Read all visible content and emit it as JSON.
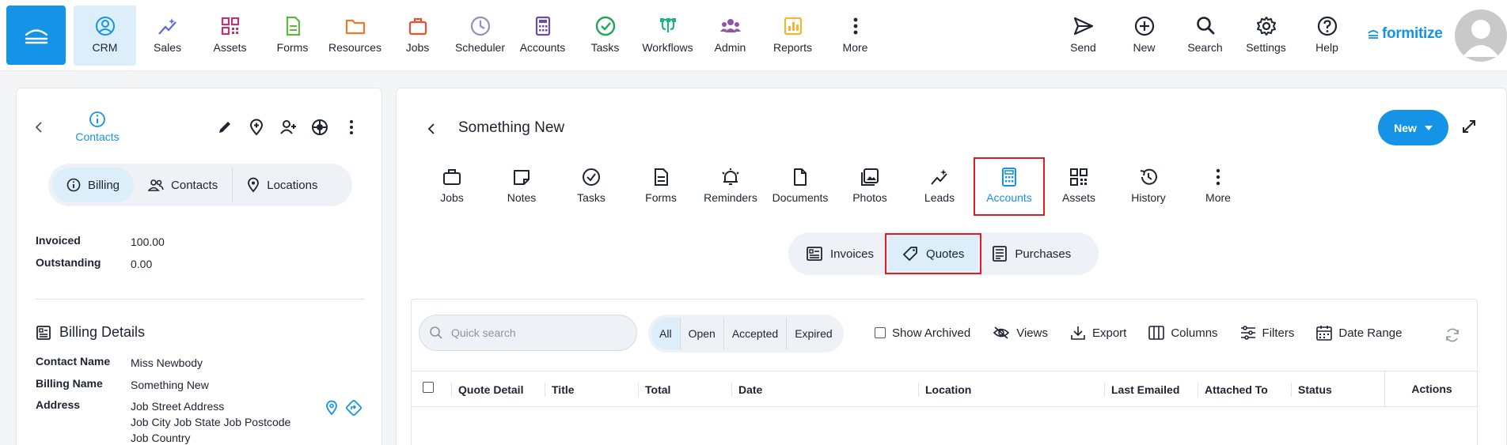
{
  "nav": {
    "items": [
      {
        "label": "CRM",
        "icon": "crm-icon",
        "color": "#1593e6",
        "active": true
      },
      {
        "label": "Sales",
        "icon": "sales-icon",
        "color": "#5b6bd8"
      },
      {
        "label": "Assets",
        "icon": "assets-icon",
        "color": "#b23a74"
      },
      {
        "label": "Forms",
        "icon": "forms-icon",
        "color": "#62b540"
      },
      {
        "label": "Resources",
        "icon": "resources-icon",
        "color": "#ef7a2c"
      },
      {
        "label": "Jobs",
        "icon": "jobs-icon",
        "color": "#e8502f"
      },
      {
        "label": "Scheduler",
        "icon": "scheduler-icon",
        "color": "#9b8ac4"
      },
      {
        "label": "Accounts",
        "icon": "accounts-icon",
        "color": "#6a4ab5"
      },
      {
        "label": "Tasks",
        "icon": "tasks-icon",
        "color": "#23a455"
      },
      {
        "label": "Workflows",
        "icon": "workflows-icon",
        "color": "#21b08b"
      },
      {
        "label": "Admin",
        "icon": "admin-icon",
        "color": "#8e55a8"
      },
      {
        "label": "Reports",
        "icon": "reports-icon",
        "color": "#f1b634"
      },
      {
        "label": "More",
        "icon": "more-icon",
        "color": "#1d2330"
      }
    ],
    "right": [
      {
        "label": "Send",
        "icon": "send-icon"
      },
      {
        "label": "New",
        "icon": "new-icon"
      },
      {
        "label": "Search",
        "icon": "search-icon"
      },
      {
        "label": "Settings",
        "icon": "settings-icon"
      },
      {
        "label": "Help",
        "icon": "help-icon"
      }
    ],
    "logo": "formitize"
  },
  "left": {
    "contacts_label": "Contacts",
    "segments": [
      {
        "label": "Billing",
        "icon": "info-icon",
        "active": true
      },
      {
        "label": "Contacts",
        "icon": "people-icon"
      },
      {
        "label": "Locations",
        "icon": "location-icon"
      }
    ],
    "invoiced_label": "Invoiced",
    "invoiced_value": "100.00",
    "outstanding_label": "Outstanding",
    "outstanding_value": "0.00",
    "billing_details_title": "Billing Details",
    "contact_name_label": "Contact Name",
    "contact_name_value": "Miss Newbody",
    "billing_name_label": "Billing Name",
    "billing_name_value": "Something New",
    "address_label": "Address",
    "address_line1": "Job Street Address",
    "address_line2": "Job City Job State Job Postcode",
    "address_line3": "Job Country"
  },
  "main": {
    "title": "Something New",
    "new_label": "New",
    "tabs": [
      {
        "label": "Jobs",
        "icon": "briefcase-icon"
      },
      {
        "label": "Notes",
        "icon": "note-icon"
      },
      {
        "label": "Tasks",
        "icon": "check-circle-icon"
      },
      {
        "label": "Forms",
        "icon": "form-icon"
      },
      {
        "label": "Reminders",
        "icon": "alarm-icon"
      },
      {
        "label": "Documents",
        "icon": "document-icon"
      },
      {
        "label": "Photos",
        "icon": "photos-icon"
      },
      {
        "label": "Leads",
        "icon": "leads-icon"
      },
      {
        "label": "Accounts",
        "icon": "calculator-icon",
        "active": true
      },
      {
        "label": "Assets",
        "icon": "qr-icon"
      },
      {
        "label": "History",
        "icon": "history-icon"
      },
      {
        "label": "More",
        "icon": "more-icon"
      }
    ],
    "subtabs": [
      {
        "label": "Invoices",
        "icon": "invoice-icon"
      },
      {
        "label": "Quotes",
        "icon": "tag-icon",
        "active": true
      },
      {
        "label": "Purchases",
        "icon": "purchase-icon"
      }
    ],
    "search_placeholder": "Quick search",
    "filters": [
      "All",
      "Open",
      "Accepted",
      "Expired"
    ],
    "tools": {
      "show_archived": "Show Archived",
      "views": "Views",
      "export": "Export",
      "columns": "Columns",
      "filters": "Filters",
      "date_range": "Date Range"
    },
    "columns": [
      "Quote Detail",
      "Title",
      "Total",
      "Date",
      "Location",
      "Last Emailed",
      "Attached To",
      "Status",
      "Actions"
    ]
  }
}
